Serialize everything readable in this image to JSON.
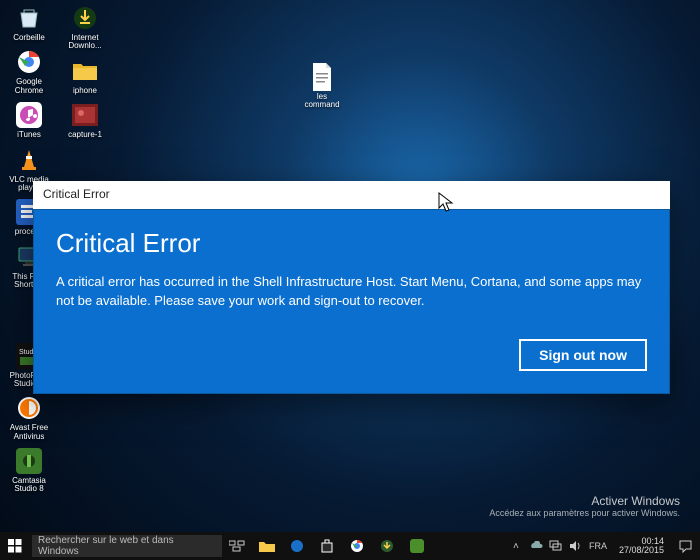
{
  "desktop_icons_col1": [
    {
      "name": "recycle-bin-icon",
      "label": "Corbeille"
    },
    {
      "name": "chrome-icon",
      "label": "Google Chrome"
    },
    {
      "name": "itunes-icon",
      "label": "iTunes"
    },
    {
      "name": "vlc-icon",
      "label": "VLC media player"
    },
    {
      "name": "procexp-icon",
      "label": "procexp"
    },
    {
      "name": "thispc-icon",
      "label": "This PC - Shortcut"
    },
    {
      "name": "gap",
      "label": ""
    },
    {
      "name": "photofiltre-icon",
      "label": "PhotoFiltre Studio X"
    },
    {
      "name": "avast-icon",
      "label": "Avast Free Antivirus"
    },
    {
      "name": "camtasia-icon",
      "label": "Camtasia Studio 8"
    }
  ],
  "desktop_icons_col2": [
    {
      "name": "idm-icon",
      "label": "Internet Downlo..."
    },
    {
      "name": "iphone-folder-icon",
      "label": "iphone"
    },
    {
      "name": "capture-icon",
      "label": "capture-1"
    }
  ],
  "free_icon": {
    "name": "textfile-icon",
    "label": "les command"
  },
  "dialog": {
    "title": "Critical Error",
    "heading": "Critical Error",
    "body": "A critical error has occurred in the Shell Infrastructure Host. Start Menu, Cortana, and some apps may not be available.  Please save your work and sign-out to recover.",
    "action": "Sign out now"
  },
  "watermark": {
    "line1": "Activer Windows",
    "line2": "Accédez aux paramètres pour activer Windows."
  },
  "taskbar": {
    "search_placeholder": "Rechercher sur le web et dans Windows",
    "lang": "FRA",
    "time": "00:14",
    "date": "27/08/2015"
  }
}
